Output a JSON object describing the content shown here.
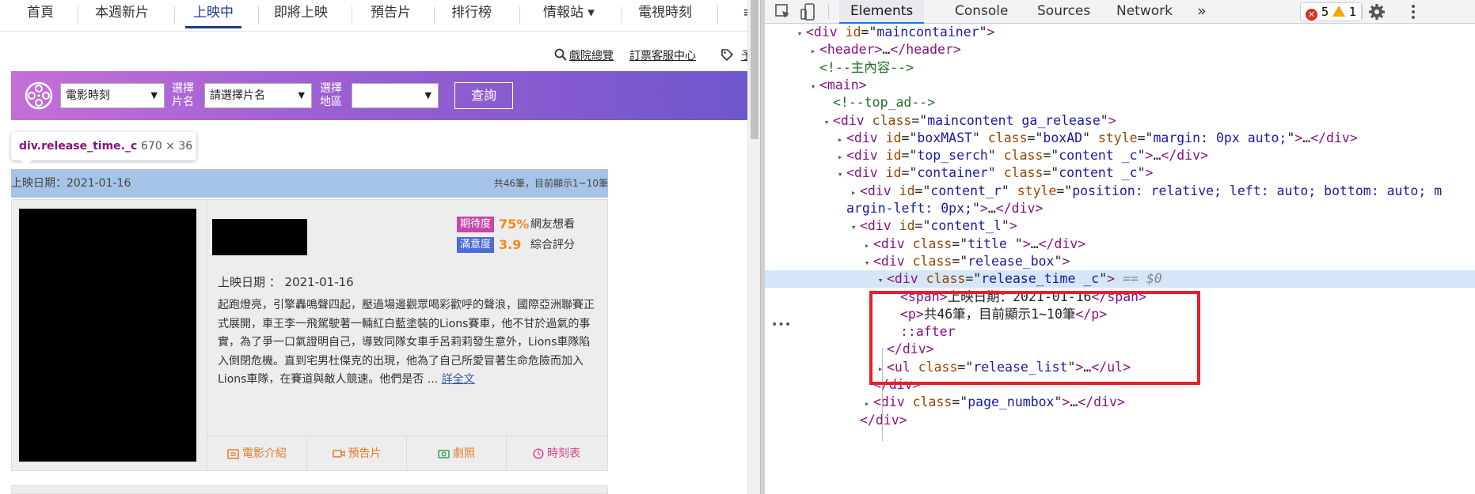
{
  "site": {
    "nav": {
      "items": [
        "首頁",
        "本週新片",
        "上映中",
        "即將上映",
        "預告片",
        "排行榜",
        "情報站 ▾",
        "電視時刻"
      ],
      "active": "上映中",
      "overflow": "≡"
    },
    "utility_links": [
      "戲院總覽",
      "訂票客服中心"
    ],
    "search": {
      "type_select": "電影時刻",
      "film_label": "選擇\n片名",
      "film_select": "請選擇片名",
      "area_label": "選擇\n地區",
      "area_select": "",
      "query_button": "查詢"
    },
    "tooltip": {
      "tag": "div.release_time._c",
      "dims": "670 × 36"
    },
    "release_time": {
      "date": "上映日期：2021-01-16",
      "count": "共46筆，目前顯示1~10筆"
    },
    "movie": {
      "expect": {
        "badge": "期待度",
        "value": "75%",
        "label": "網友想看"
      },
      "satisfy": {
        "badge": "滿意度",
        "value": "3.9",
        "label": "綜合評分"
      },
      "release_date": "上映日期 ： 2021-01-16",
      "synopsis": "起跑燈亮，引擎轟鳴聲四起，壓過場邊觀眾喝彩歡呼的聲浪，國際亞洲聯賽正式展開，車王李一飛駕駛著一輛紅白藍塗裝的Lions賽車，他不甘於過氣的事實，為了爭一口氣證明自己，導致同隊女車手呂莉莉發生意外，Lions車隊陷入倒閉危機。直到宅男杜傑克的出現，他為了自己所愛冒著生命危險而加入Lions車隊，在賽道與敵人競速。他們是否 ...",
      "more": "詳全文",
      "actions": [
        "電影介紹",
        "預告片",
        "劇照",
        "時刻表"
      ]
    },
    "colors": {
      "accent": "#1e3a8a",
      "banner_from": "#c56fd8",
      "banner_to": "#6e57cc",
      "release_bar": "#a6c4e7",
      "orange": "#e07b2a"
    }
  },
  "devtools": {
    "tabs": [
      "Elements",
      "Console",
      "Sources",
      "Network"
    ],
    "active_tab": "Elements",
    "more_tabs": "»",
    "errors": "5",
    "warnings": "1",
    "tree": [
      {
        "indent": 0,
        "arrow": "▾",
        "html": "<span class='tn'>&lt;div </span><span class='an'>id</span>=\"<span class='av'>maincontainer</span>\"<span class='tn'>&gt;</span>"
      },
      {
        "indent": 1,
        "arrow": "▸",
        "html": "<span class='tn'>&lt;header&gt;</span>…<span class='tn'>&lt;/header&gt;</span>"
      },
      {
        "indent": 1,
        "arrow": "",
        "html": "<span class='cm'>&lt;!--主內容--&gt;</span>"
      },
      {
        "indent": 1,
        "arrow": "▾",
        "html": "<span class='tn'>&lt;main&gt;</span>"
      },
      {
        "indent": 2,
        "arrow": "",
        "html": "<span class='cm'>&lt;!--top_ad--&gt;</span>"
      },
      {
        "indent": 2,
        "arrow": "▾",
        "html": "<span class='tn'>&lt;div </span><span class='an'>class</span>=\"<span class='av'>maincontent ga_release</span>\"<span class='tn'>&gt;</span>"
      },
      {
        "indent": 3,
        "arrow": "▸",
        "html": "<span class='tn'>&lt;div </span><span class='an'>id</span>=\"<span class='av'>boxMAST</span>\" <span class='an'>class</span>=\"<span class='av'>boxAD</span>\" <span class='an'>style</span>=\"<span class='av'>margin: 0px auto;</span>\"<span class='tn'>&gt;</span>…<span class='tn'>&lt;/div&gt;</span>"
      },
      {
        "indent": 3,
        "arrow": "▸",
        "html": "<span class='tn'>&lt;div </span><span class='an'>id</span>=\"<span class='av'>top_serch</span>\" <span class='an'>class</span>=\"<span class='av'>content _c</span>\"<span class='tn'>&gt;</span>…<span class='tn'>&lt;/div&gt;</span>"
      },
      {
        "indent": 3,
        "arrow": "▾",
        "html": "<span class='tn'>&lt;div </span><span class='an'>id</span>=\"<span class='av'>container</span>\" <span class='an'>class</span>=\"<span class='av'>content _c</span>\"<span class='tn'>&gt;</span>"
      },
      {
        "indent": 4,
        "arrow": "▸",
        "html": "<span class='tn'>&lt;div </span><span class='an'>id</span>=\"<span class='av'>content_r</span>\" <span class='an'>style</span>=\"<span class='av'>position: relative; left: auto; bottom: auto; m</span>"
      },
      {
        "indent": 3,
        "arrow": "",
        "html": "<span class='av'>argin-left: 0px;</span>\"<span class='tn'>&gt;</span>…<span class='tn'>&lt;/div&gt;</span>"
      },
      {
        "indent": 4,
        "arrow": "▾",
        "html": "<span class='tn'>&lt;div </span><span class='an'>id</span>=\"<span class='av'>content_l</span>\"<span class='tn'>&gt;</span>"
      },
      {
        "indent": 5,
        "arrow": "▸",
        "html": "<span class='tn'>&lt;div </span><span class='an'>class</span>=\"<span class='av'>title </span>\"<span class='tn'>&gt;</span>…<span class='tn'>&lt;/div&gt;</span>"
      },
      {
        "indent": 5,
        "arrow": "▾",
        "html": "<span class='tn'>&lt;div </span><span class='an'>class</span>=\"<span class='av'>release_box</span>\"<span class='tn'>&gt;</span>"
      },
      {
        "indent": 6,
        "arrow": "▾",
        "selected": true,
        "html": "<span class='tn'>&lt;div </span><span class='an'>class</span>=\"<span class='av'>release_time _c</span>\"<span class='tn'>&gt;</span> <span class='eq'>== $0</span>"
      },
      {
        "indent": 7,
        "arrow": "",
        "html": "<span class='tn'>&lt;span&gt;</span>上映日期：2021-01-16<span class='tn'>&lt;/span&gt;</span>"
      },
      {
        "indent": 7,
        "arrow": "",
        "html": "<span class='tn'>&lt;p&gt;</span>共46筆，目前顯示1~10筆<span class='tn'>&lt;/p&gt;</span>"
      },
      {
        "indent": 7,
        "arrow": "",
        "html": "<span class='ps'>::after</span>"
      },
      {
        "indent": 6,
        "arrow": "",
        "html": "<span class='tn'>&lt;/div&gt;</span>"
      },
      {
        "indent": 6,
        "arrow": "▸",
        "html": "<span class='tn'>&lt;ul </span><span class='an'>class</span>=\"<span class='av'>release_list</span>\"<span class='tn'>&gt;</span>…<span class='tn'>&lt;/ul&gt;</span>"
      },
      {
        "indent": 5,
        "arrow": "",
        "html": "<span class='tn'>&lt;/div&gt;</span>"
      },
      {
        "indent": 5,
        "arrow": "▸",
        "html": "<span class='tn'>&lt;div </span><span class='an'>class</span>=\"<span class='av'>page_numbox</span>\"<span class='tn'>&gt;</span>…<span class='tn'>&lt;/div&gt;</span>"
      },
      {
        "indent": 4,
        "arrow": "",
        "html": "<span class='tn'>&lt;/div&gt;</span>"
      }
    ]
  }
}
